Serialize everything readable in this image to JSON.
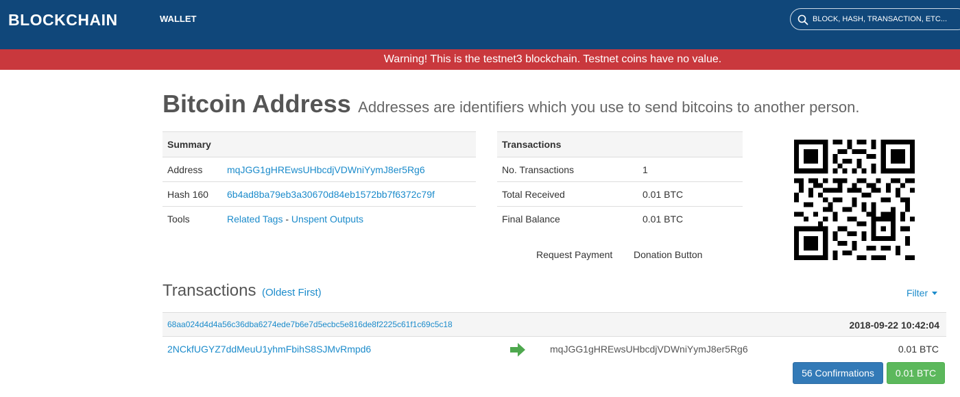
{
  "header": {
    "logo": "BLOCKCHAIN",
    "nav_wallet": "WALLET",
    "search_placeholder": "BLOCK, HASH, TRANSACTION, ETC...",
    "bg_color": "#10477a"
  },
  "warning": {
    "text": "Warning! This is the testnet3 blockchain. Testnet coins have no value.",
    "bg_color": "#c9383d"
  },
  "page": {
    "title": "Bitcoin Address",
    "subtitle": "Addresses are identifiers which you use to send bitcoins to another person."
  },
  "summary": {
    "header": "Summary",
    "rows": [
      {
        "label": "Address",
        "value": "mqJGG1gHREwsUHbcdjVDWniYymJ8er5Rg6"
      },
      {
        "label": "Hash 160",
        "value": "6b4ad8ba79eb3a30670d84eb1572bb7f6372c79f"
      },
      {
        "label": "Tools",
        "link1": "Related Tags",
        "separator": " - ",
        "link2": "Unspent Outputs"
      }
    ]
  },
  "tx_summary": {
    "header": "Transactions",
    "rows": [
      {
        "label": "No. Transactions",
        "value": "1"
      },
      {
        "label": "Total Received",
        "value": "0.01 BTC"
      },
      {
        "label": "Final Balance",
        "value": "0.01 BTC"
      }
    ]
  },
  "actions": {
    "request_payment": "Request Payment",
    "donation_button": "Donation Button"
  },
  "transactions": {
    "title": "Transactions",
    "sort_label": "(Oldest First)",
    "filter_label": "Filter",
    "items": [
      {
        "hash": "68aa024d4d4a56c36dba6274ede7b6e7d5ecbc5e816de8f2225c61f1c69c5c18",
        "time": "2018-09-22 10:42:04",
        "from": "2NCkfUGYZ7ddMeuU1yhmFbihS8SJMvRmpd6",
        "to": "mqJGG1gHREwsUHbcdjVDWniYymJ8er5Rg6",
        "amount": "0.01 BTC",
        "confirmations": "56 Confirmations",
        "total": "0.01 BTC"
      }
    ]
  },
  "icons": {
    "search": "search-icon",
    "arrow": "arrow-right-icon",
    "caret": "caret-down-icon",
    "qr": "qr-code-icon"
  },
  "colors": {
    "link": "#1b8bcb",
    "positive": "#1b8f1b",
    "confirm_button": "#337ab7",
    "amount_button": "#5cb85c"
  }
}
